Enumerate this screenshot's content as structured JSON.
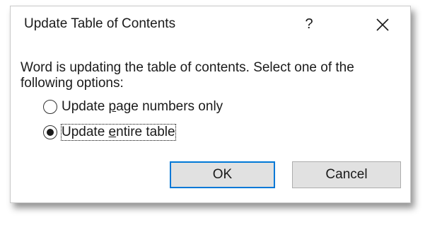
{
  "dialog": {
    "title": "Update Table of Contents",
    "help_label": "?",
    "message": "Word is updating the table of contents.  Select one of the following options:",
    "options": [
      {
        "pre": "Update ",
        "key": "p",
        "post": "age numbers only",
        "selected": false
      },
      {
        "pre": "Update ",
        "key": "e",
        "post": "ntire table",
        "selected": true
      }
    ],
    "ok_label": "OK",
    "cancel_label": "Cancel"
  },
  "icons": {
    "close": "close-icon"
  },
  "colors": {
    "focus_border": "#0078d7",
    "button_face": "#e1e1e1"
  }
}
